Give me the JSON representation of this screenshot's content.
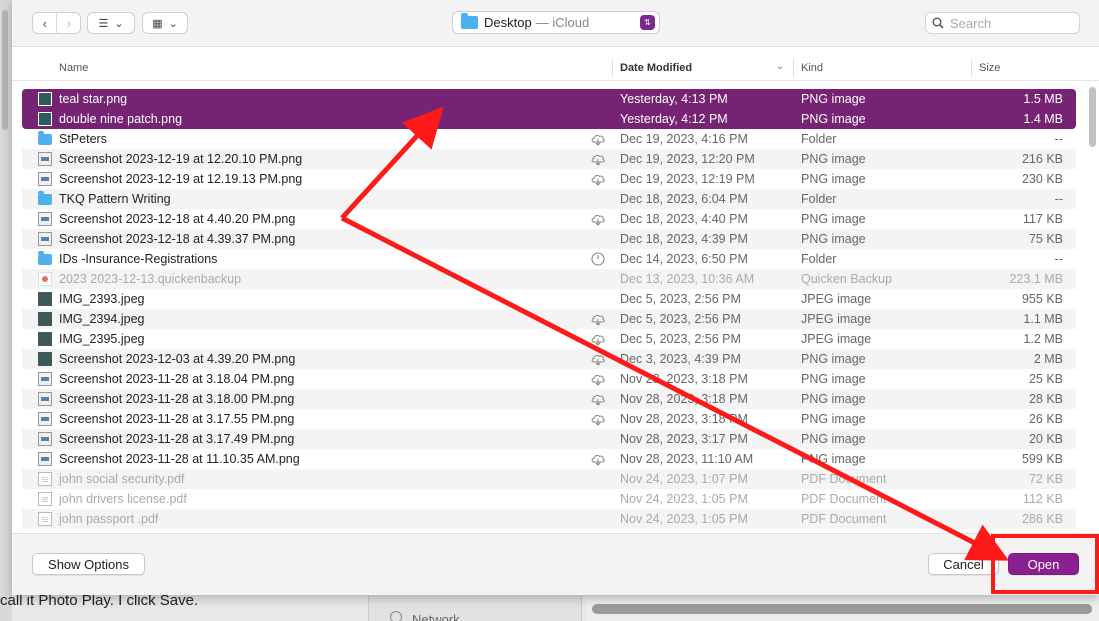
{
  "background": {
    "caption": "call it Photo Play. I click Save.",
    "sidebar_item": "Network"
  },
  "toolbar": {
    "back": "‹",
    "forward": "›",
    "list_view": "☰",
    "group_view": "▦",
    "chevron": "⌄",
    "location": "Desktop",
    "location_sub": "— iCloud",
    "stepper": "⇅",
    "search_placeholder": "Search"
  },
  "columns": {
    "name": "Name",
    "date": "Date Modified",
    "kind": "Kind",
    "size": "Size"
  },
  "files": [
    {
      "name": "teal star.png",
      "date": "Yesterday, 4:13 PM",
      "kind": "PNG image",
      "size": "1.5 MB",
      "icon": "image-thumbnail-icon",
      "cloud": "",
      "selected": true
    },
    {
      "name": "double nine patch.png",
      "date": "Yesterday, 4:12 PM",
      "kind": "PNG image",
      "size": "1.4 MB",
      "icon": "image-thumbnail-icon",
      "cloud": "",
      "selected": true
    },
    {
      "name": "StPeters",
      "date": "Dec 19, 2023, 4:16 PM",
      "kind": "Folder",
      "size": "--",
      "icon": "folder-icon",
      "cloud": "cloud-download-icon"
    },
    {
      "name": "Screenshot 2023-12-19 at 12.20.10 PM.png",
      "date": "Dec 19, 2023, 12:20 PM",
      "kind": "PNG image",
      "size": "216 KB",
      "icon": "png-file-icon",
      "cloud": "cloud-download-icon"
    },
    {
      "name": "Screenshot 2023-12-19 at 12.19.13 PM.png",
      "date": "Dec 19, 2023, 12:19 PM",
      "kind": "PNG image",
      "size": "230 KB",
      "icon": "png-file-icon",
      "cloud": "cloud-download-icon"
    },
    {
      "name": "TKQ Pattern Writing",
      "date": "Dec 18, 2023, 6:04 PM",
      "kind": "Folder",
      "size": "--",
      "icon": "folder-icon",
      "cloud": ""
    },
    {
      "name": "Screenshot 2023-12-18 at 4.40.20 PM.png",
      "date": "Dec 18, 2023, 4:40 PM",
      "kind": "PNG image",
      "size": "117 KB",
      "icon": "png-file-icon",
      "cloud": "cloud-download-icon"
    },
    {
      "name": "Screenshot 2023-12-18 at 4.39.37 PM.png",
      "date": "Dec 18, 2023, 4:39 PM",
      "kind": "PNG image",
      "size": "75 KB",
      "icon": "png-file-icon",
      "cloud": ""
    },
    {
      "name": "IDs -Insurance-Registrations",
      "date": "Dec 14, 2023, 6:50 PM",
      "kind": "Folder",
      "size": "--",
      "icon": "folder-icon",
      "cloud": "clock-icon"
    },
    {
      "name": "2023 2023-12-13.quickenbackup",
      "date": "Dec 13, 2023, 10:36 AM",
      "kind": "Quicken Backup",
      "size": "223.1 MB",
      "icon": "quicken-file-icon",
      "cloud": "",
      "dim": true
    },
    {
      "name": "IMG_2393.jpeg",
      "date": "Dec 5, 2023, 2:56 PM",
      "kind": "JPEG image",
      "size": "955 KB",
      "icon": "image-thumbnail-icon",
      "cloud": ""
    },
    {
      "name": "IMG_2394.jpeg",
      "date": "Dec 5, 2023, 2:56 PM",
      "kind": "JPEG image",
      "size": "1.1 MB",
      "icon": "image-thumbnail-icon",
      "cloud": "cloud-download-icon"
    },
    {
      "name": "IMG_2395.jpeg",
      "date": "Dec 5, 2023, 2:56 PM",
      "kind": "JPEG image",
      "size": "1.2 MB",
      "icon": "image-thumbnail-icon",
      "cloud": "cloud-download-icon"
    },
    {
      "name": "Screenshot 2023-12-03 at 4.39.20 PM.png",
      "date": "Dec 3, 2023, 4:39 PM",
      "kind": "PNG image",
      "size": "2 MB",
      "icon": "image-thumbnail-icon",
      "cloud": "cloud-download-icon"
    },
    {
      "name": "Screenshot 2023-11-28 at 3.18.04 PM.png",
      "date": "Nov 28, 2023, 3:18 PM",
      "kind": "PNG image",
      "size": "25 KB",
      "icon": "png-file-icon",
      "cloud": "cloud-download-icon"
    },
    {
      "name": "Screenshot 2023-11-28 at 3.18.00 PM.png",
      "date": "Nov 28, 2023, 3:18 PM",
      "kind": "PNG image",
      "size": "28 KB",
      "icon": "png-file-icon",
      "cloud": "cloud-download-icon"
    },
    {
      "name": "Screenshot 2023-11-28 at 3.17.55 PM.png",
      "date": "Nov 28, 2023, 3:18 PM",
      "kind": "PNG image",
      "size": "26 KB",
      "icon": "png-file-icon",
      "cloud": "cloud-download-icon"
    },
    {
      "name": "Screenshot 2023-11-28 at 3.17.49 PM.png",
      "date": "Nov 28, 2023, 3:17 PM",
      "kind": "PNG image",
      "size": "20 KB",
      "icon": "png-file-icon",
      "cloud": ""
    },
    {
      "name": "Screenshot 2023-11-28 at 11.10.35 AM.png",
      "date": "Nov 28, 2023, 11:10 AM",
      "kind": "PNG image",
      "size": "599 KB",
      "icon": "png-file-icon",
      "cloud": "cloud-download-icon"
    },
    {
      "name": "john social security.pdf",
      "date": "Nov 24, 2023, 1:07 PM",
      "kind": "PDF Document",
      "size": "72 KB",
      "icon": "pdf-file-icon",
      "cloud": "",
      "dim": true
    },
    {
      "name": "john drivers license.pdf",
      "date": "Nov 24, 2023, 1:05 PM",
      "kind": "PDF Document",
      "size": "112 KB",
      "icon": "pdf-file-icon",
      "cloud": "",
      "dim": true
    },
    {
      "name": "john passport .pdf",
      "date": "Nov 24, 2023, 1:05 PM",
      "kind": "PDF Document",
      "size": "286 KB",
      "icon": "pdf-file-icon",
      "cloud": "",
      "dim": true
    }
  ],
  "footer": {
    "show_options": "Show Options",
    "cancel": "Cancel",
    "open": "Open"
  },
  "colors": {
    "selection": "#762373",
    "accent": "#8a1f8f",
    "annotation": "#ff1a1a"
  }
}
